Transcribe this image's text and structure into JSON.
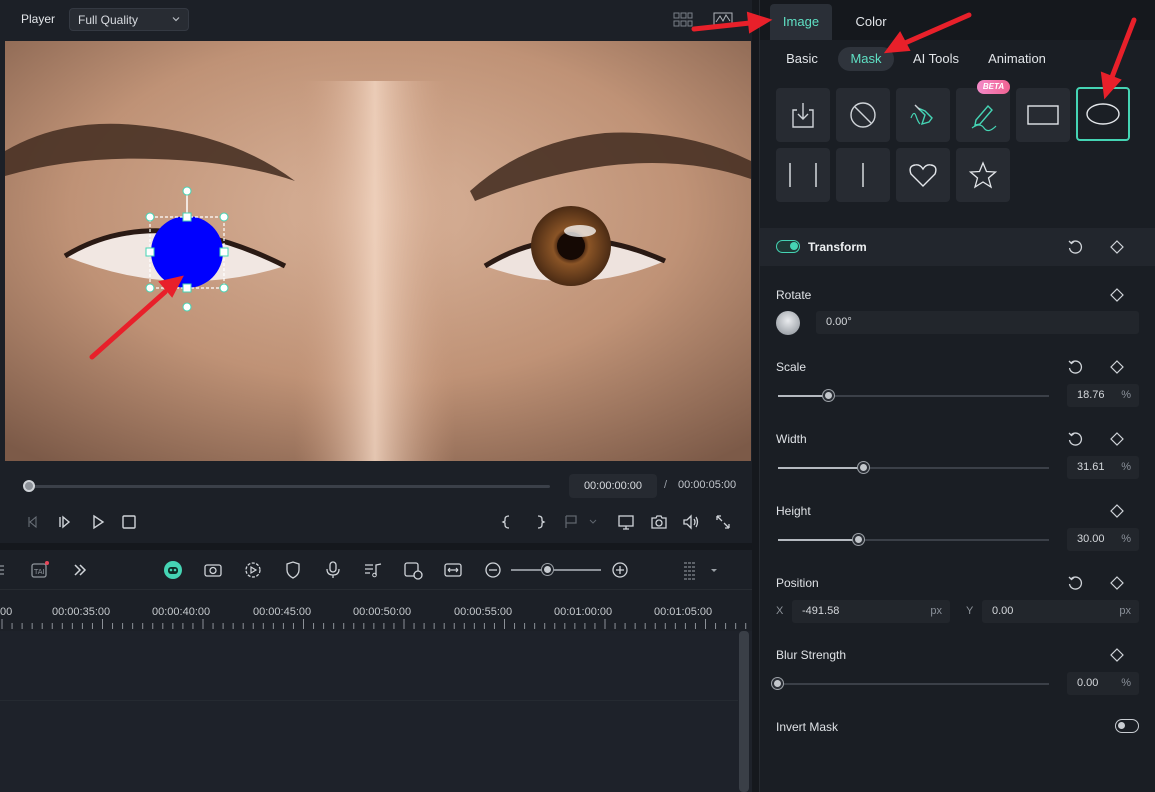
{
  "player": {
    "label": "Player",
    "quality": "Full Quality",
    "current_time": "00:00:00:00",
    "separator": "/",
    "total_time": "00:00:05:00",
    "progress_fraction": 0
  },
  "timeline": {
    "zoom_fraction": 0.4,
    "ruler": [
      "00",
      "00:00:35:00",
      "00:00:40:00",
      "00:00:45:00",
      "00:00:50:00",
      "00:00:55:00",
      "00:01:00:00",
      "00:01:05:00"
    ]
  },
  "panel": {
    "top_tabs": [
      "Image",
      "Color"
    ],
    "active_top_tab": "Image",
    "sub_tabs": [
      "Basic",
      "Mask",
      "AI Tools",
      "Animation"
    ],
    "active_sub_tab": "Mask",
    "beta_badge": "BETA",
    "shapes": [
      "import-mask",
      "no-mask",
      "pen-tool",
      "draw-mask",
      "rectangle",
      "ellipse",
      "split-line",
      "single-line",
      "heart",
      "star"
    ],
    "selected_shape": "ellipse",
    "section_title": "Transform",
    "rotate": {
      "label": "Rotate",
      "value": "0.00°"
    },
    "scale": {
      "label": "Scale",
      "value": "18.76",
      "unit": "%",
      "level": 18.76
    },
    "width": {
      "label": "Width",
      "value": "31.61",
      "unit": "%",
      "level": 31.61
    },
    "height": {
      "label": "Height",
      "value": "30.00",
      "unit": "%",
      "level": 30.0
    },
    "position": {
      "label": "Position",
      "x_label": "X",
      "x_value": "-491.58",
      "y_label": "Y",
      "y_value": "0.00",
      "unit": "px"
    },
    "blur": {
      "label": "Blur Strength",
      "value": "0.00",
      "unit": "%",
      "level": 0
    },
    "invert_mask": {
      "label": "Invert Mask",
      "on": false
    }
  },
  "colors": {
    "accent": "#45d4b4",
    "annotation": "#e8202a",
    "mask_fill": "#0000ff"
  }
}
